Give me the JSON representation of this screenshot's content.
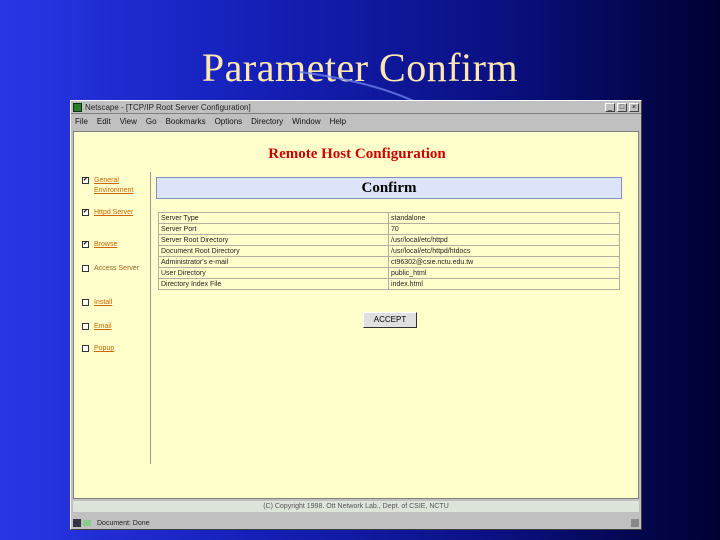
{
  "slide": {
    "title": "Parameter Confirm"
  },
  "window": {
    "title": "Netscape - [TCP/IP Root Server Configuration]",
    "controls": {
      "minimize": "_",
      "maximize": "□",
      "close": "×"
    }
  },
  "menu": [
    "File",
    "Edit",
    "View",
    "Go",
    "Bookmarks",
    "Options",
    "Directory",
    "Window",
    "Help"
  ],
  "page": {
    "heading": "Remote Host Configuration",
    "confirm_label": "Confirm",
    "accept_label": "ACCEPT",
    "footer": "(C) Copyright 1998. Ott Network Lab., Dept. of CSIE, NCTU"
  },
  "sidebar": [
    {
      "checked": true,
      "label": "General Environment"
    },
    {
      "checked": true,
      "label": "Httpd Server"
    },
    {
      "checked": true,
      "label": "Browse"
    },
    {
      "checked": false,
      "label": "Access Server"
    },
    {
      "checked": false,
      "label": "Install"
    },
    {
      "checked": false,
      "label": "Email"
    },
    {
      "checked": false,
      "label": "Popup"
    }
  ],
  "params": [
    {
      "key": "Server Type",
      "value": "standalone"
    },
    {
      "key": "Server Port",
      "value": "70"
    },
    {
      "key": "Server Root Directory",
      "value": "/usr/local/etc/httpd"
    },
    {
      "key": "Document Root Directory",
      "value": "/usr/local/etc/httpd/htdocs"
    },
    {
      "key": "Administrator's e-mail",
      "value": "ct96302@csie.nctu.edu.tw"
    },
    {
      "key": "User Directory",
      "value": "public_html"
    },
    {
      "key": "Directory Index File",
      "value": "index.html"
    }
  ],
  "status": {
    "text": "Document: Done"
  }
}
